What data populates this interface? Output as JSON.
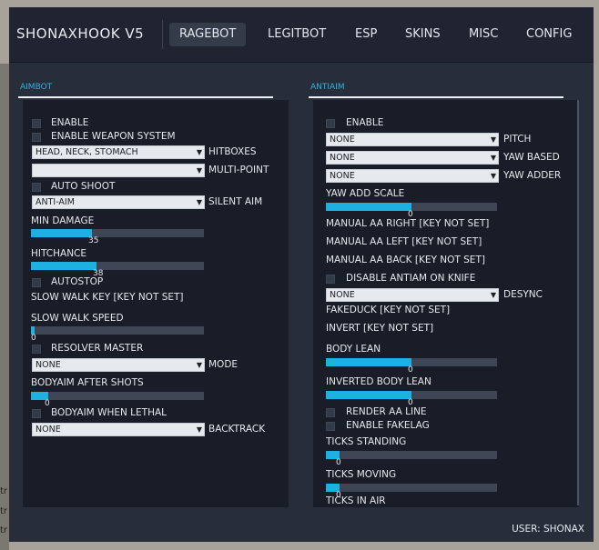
{
  "window": {
    "brand": "SHONAXHOOK V5",
    "user_label": "USER: SHONAX"
  },
  "tabs": [
    {
      "label": "RAGEBOT",
      "active": true
    },
    {
      "label": "LEGITBOT",
      "active": false
    },
    {
      "label": "ESP",
      "active": false
    },
    {
      "label": "SKINS",
      "active": false
    },
    {
      "label": "MISC",
      "active": false
    },
    {
      "label": "CONFIG",
      "active": false
    }
  ],
  "aimbot": {
    "title": "AIMBOT",
    "enable": "ENABLE",
    "weapon_system": "ENABLE WEAPON SYSTEM",
    "hitboxes_value": "HEAD, NECK, STOMACH",
    "hitboxes_label": "HITBOXES",
    "multipoint_value": "",
    "multipoint_label": "MULTI-POINT",
    "auto_shoot": "AUTO SHOOT",
    "silent_value": "ANTI-AIM",
    "silent_label": "SILENT AIM",
    "min_damage_label": "MIN DAMAGE",
    "min_damage_value": "35",
    "min_damage_fill": 0.35,
    "hitchance_label": "HITCHANCE",
    "hitchance_value": "38",
    "hitchance_fill": 0.38,
    "autostop": "AUTOSTOP",
    "slow_walk_key": "SLOW WALK KEY  [KEY NOT SET]",
    "slow_walk_speed_label": "SLOW WALK SPEED",
    "slow_walk_speed_value": "0",
    "slow_walk_speed_fill": 0.02,
    "resolver": "RESOLVER MASTER",
    "mode_value": "NONE",
    "mode_label": "MODE",
    "bodyaim_label": "BODYAIM AFTER SHOTS",
    "bodyaim_value": "0",
    "bodyaim_fill": 0.1,
    "bodyaim_lethal": "BODYAIM WHEN LETHAL",
    "backtrack_value": "NONE",
    "backtrack_label": "BACKTRACK"
  },
  "antiaim": {
    "title": "ANTIAIM",
    "enable": "ENABLE",
    "pitch_value": "NONE",
    "pitch_label": "PITCH",
    "yaw_based_value": "NONE",
    "yaw_based_label": "YAW BASED",
    "yaw_adder_value": "NONE",
    "yaw_adder_label": "YAW ADDER",
    "yaw_scale_label": "YAW ADD SCALE",
    "yaw_scale_value": "0",
    "yaw_scale_fill": 0.5,
    "manual_right": "MANUAL AA RIGHT  [KEY NOT SET]",
    "manual_left": "MANUAL AA LEFT  [KEY NOT SET]",
    "manual_back": "MANUAL AA BACK  [KEY NOT SET]",
    "disable_knife": "DISABLE ANTIAM ON KNIFE",
    "desync_value": "NONE",
    "desync_label": "DESYNC",
    "fakeduck": "FAKEDUCK  [KEY NOT SET]",
    "invert": "INVERT  [KEY NOT SET]",
    "body_lean_label": "BODY LEAN",
    "body_lean_value": "0",
    "body_lean_fill": 0.5,
    "inv_body_lean_label": "INVERTED BODY LEAN",
    "inv_body_lean_value": "0",
    "inv_body_lean_fill": 0.5,
    "render_line": "RENDER AA LINE",
    "fakelag": "ENABLE FAKELAG",
    "ticks_standing_label": "TICKS STANDING",
    "ticks_standing_value": "0",
    "ticks_standing_fill": 0.08,
    "ticks_moving_label": "TICKS MOVING",
    "ticks_moving_value": "0",
    "ticks_moving_fill": 0.08,
    "ticks_air_label": "TICKS IN AIR"
  },
  "background": {
    "text": [
      "tr",
      "tr",
      "tr"
    ]
  },
  "colors": {
    "accent": "#1eb0e0",
    "title": "#2eb5e0",
    "panel": "#191d27",
    "window": "#272d39"
  }
}
